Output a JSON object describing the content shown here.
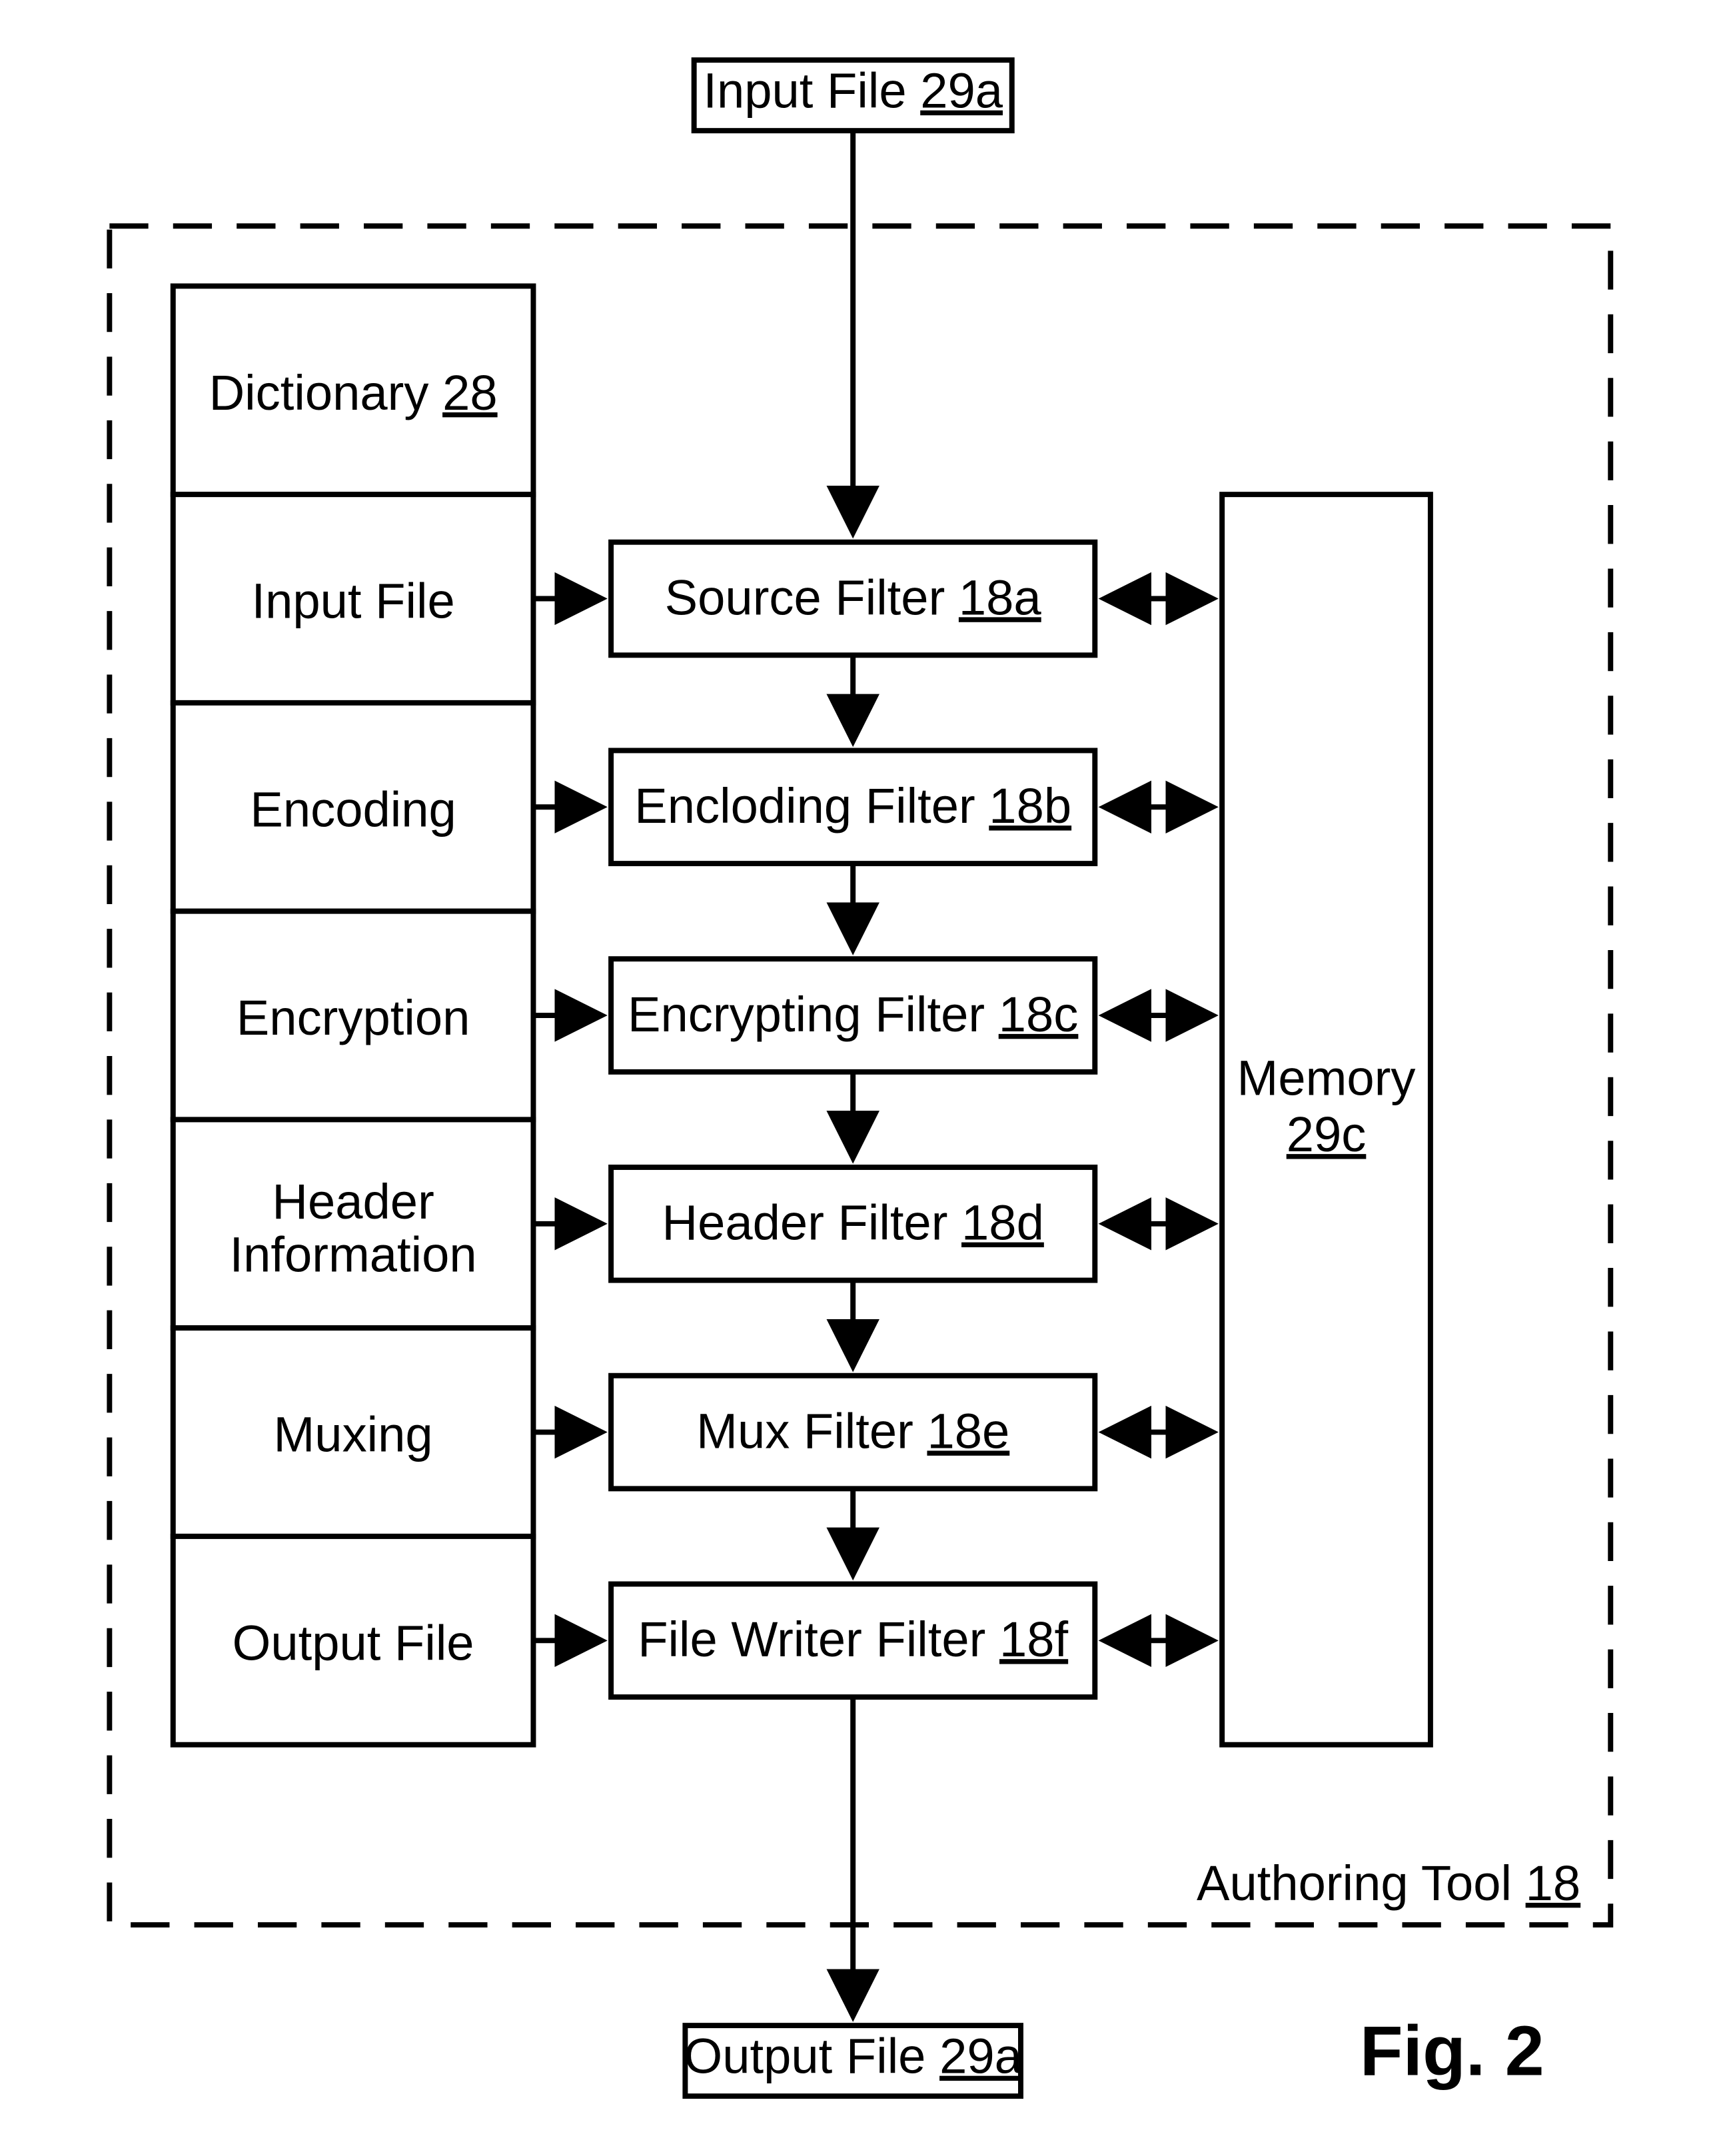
{
  "figure_caption": "Fig. 2",
  "outer": {
    "input_file": {
      "label": "Input File ",
      "ref": "29a"
    },
    "output_file": {
      "label": "Output File ",
      "ref": "29a"
    },
    "authoring_label": {
      "label": "Authoring Tool ",
      "ref": "18"
    }
  },
  "dictionary": {
    "header": {
      "label": "Dictionary ",
      "ref": "28"
    },
    "rows": [
      {
        "label": "Input File"
      },
      {
        "label": "Encoding"
      },
      {
        "label": "Encryption"
      },
      {
        "label1": "Header",
        "label2": "Information"
      },
      {
        "label": "Muxing"
      },
      {
        "label": "Output File"
      }
    ]
  },
  "filters": [
    {
      "label": "Source Filter ",
      "ref": "18a"
    },
    {
      "label": "Encloding Filter ",
      "ref": "18b"
    },
    {
      "label": "Encrypting Filter ",
      "ref": "18c"
    },
    {
      "label": "Header Filter ",
      "ref": "18d"
    },
    {
      "label": "Mux Filter ",
      "ref": "18e"
    },
    {
      "label": "File Writer Filter ",
      "ref": "18f"
    }
  ],
  "memory": {
    "label": "Memory",
    "ref": "29c"
  }
}
